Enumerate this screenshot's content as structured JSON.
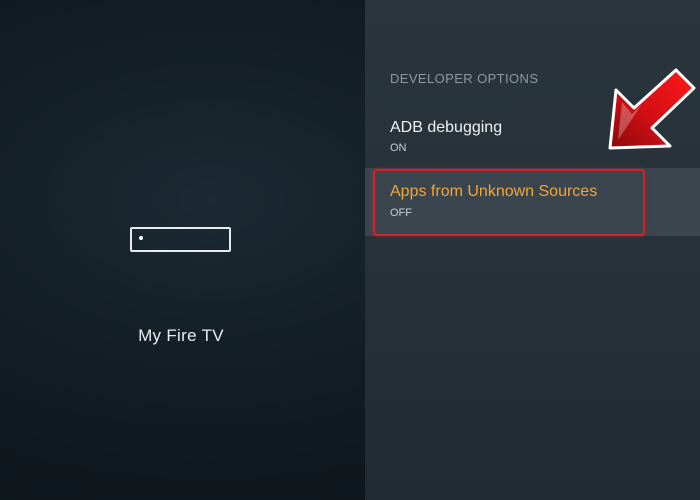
{
  "left_pane": {
    "title": "My Fire TV",
    "device_icon": "fire-tv-device-icon"
  },
  "right_pane": {
    "section_header": "DEVELOPER OPTIONS",
    "items": [
      {
        "label": "ADB debugging",
        "value": "ON"
      },
      {
        "label": "Apps from Unknown Sources",
        "value": "OFF",
        "highlighted": true
      }
    ]
  },
  "annotation": {
    "arrow_icon": "red-arrow-pointer-icon",
    "highlight_color": "#d2222a"
  },
  "colors": {
    "selected_label": "#f2a73b",
    "background": "#121c23",
    "panel": "#2a353d"
  }
}
